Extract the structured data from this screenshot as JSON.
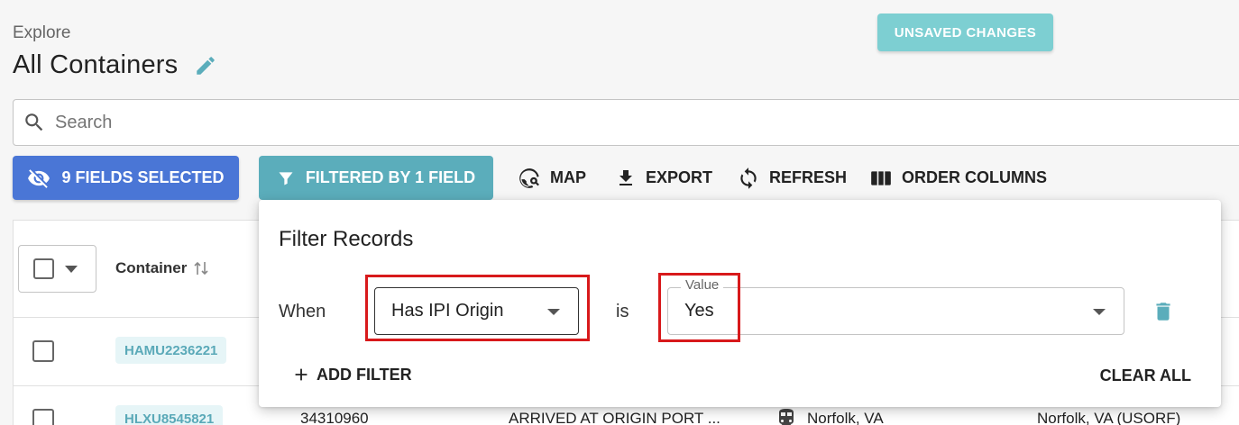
{
  "header": {
    "breadcrumb": "Explore",
    "title": "All Containers",
    "unsaved_label": "UNSAVED CHANGES"
  },
  "search": {
    "placeholder": "Search"
  },
  "toolbar": {
    "fields_selected_label": "9 FIELDS SELECTED",
    "filtered_label": "FILTERED BY 1 FIELD",
    "map_label": "MAP",
    "export_label": "EXPORT",
    "refresh_label": "REFRESH",
    "order_columns_label": "ORDER COLUMNS"
  },
  "table": {
    "columns": [
      "Container"
    ],
    "rows": [
      {
        "container": "HAMU2236221"
      },
      {
        "container": "HLXU8545821",
        "id": "34310960",
        "status": "ARRIVED AT ORIGIN PORT ...",
        "location": "Norfolk, VA",
        "destination": "Norfolk, VA (USORF)"
      }
    ]
  },
  "filter_panel": {
    "title": "Filter Records",
    "when_label": "When",
    "field_value": "Has IPI Origin",
    "is_label": "is",
    "value_legend": "Value",
    "value_value": "Yes",
    "add_filter_label": "ADD FILTER",
    "clear_all_label": "CLEAR ALL"
  },
  "colors": {
    "primary_blue": "#4a76d6",
    "teal": "#5badbb",
    "unsaved_teal": "#7dcfd2",
    "highlight_red": "#d8191b"
  }
}
